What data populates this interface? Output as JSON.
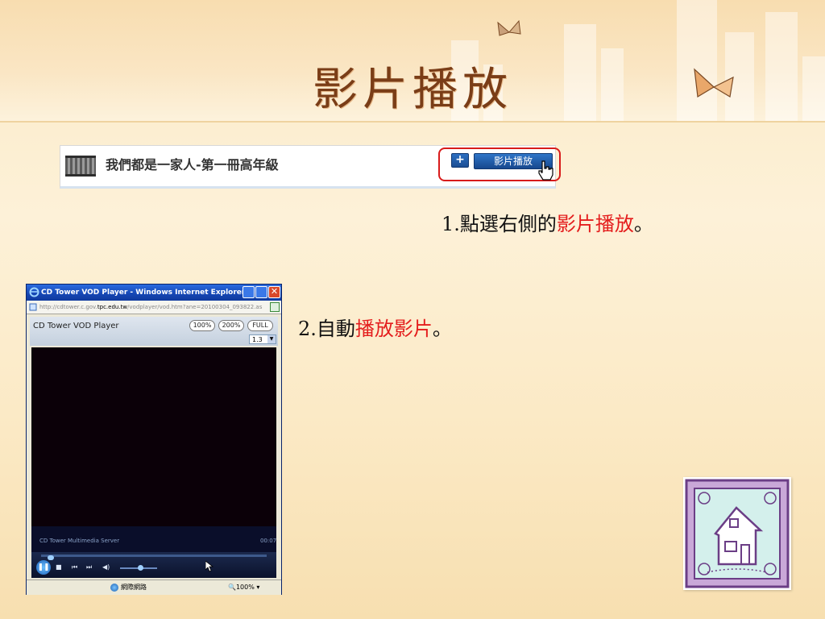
{
  "slide": {
    "title": "影片播放"
  },
  "step1_screenshot": {
    "item_title": "我們都是一家人-第一冊高年級",
    "plus_label": "+",
    "play_button_label": "影片播放"
  },
  "steps": [
    {
      "number": "1.",
      "prefix": "點選右側的",
      "highlight": "影片播放",
      "suffix": "。"
    },
    {
      "number": "2.",
      "prefix": "自動",
      "highlight": "播放影片",
      "suffix": "。"
    }
  ],
  "browser": {
    "window_title": "CD Tower VOD Player - Windows Internet Explorer",
    "close_glyph": "✕",
    "address_prefix": "http://cdtower.c.gov.",
    "address_host": "tpc.edu.tw",
    "address_suffix": "/vodplayer/vod.htm?ane=20100304_093822.as",
    "player_name": "CD Tower VOD Player",
    "zoom_100": "100%",
    "zoom_200": "200%",
    "zoom_full": "FULL",
    "speed_value": "1.3",
    "server_label": "CD Tower Multimedia Server",
    "time_readout": "00:07",
    "status_zone": "網際網路",
    "status_zoom": "100%",
    "seek_position": 0.03,
    "volume_level": 0.55
  },
  "colors": {
    "title": "#7a3d17",
    "highlight_red": "#e41d1d",
    "frame_red": "#d81b1b"
  }
}
